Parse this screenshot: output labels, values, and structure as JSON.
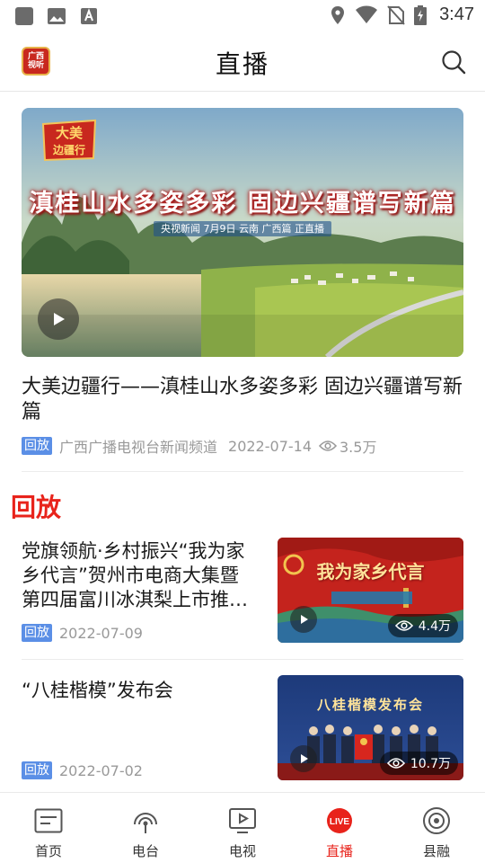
{
  "status_bar": {
    "time": "3:47"
  },
  "header": {
    "title": "直播",
    "logo_text": [
      "广西",
      "视听"
    ]
  },
  "featured": {
    "badge": [
      "大美",
      "边疆行"
    ],
    "slogan": "滇桂山水多姿多彩  固边兴疆谱写新篇",
    "subline": "央视新闻  7月9日  云南  广西篇  正直播",
    "title": "大美边疆行——滇桂山水多姿多彩 固边兴疆谱写新篇",
    "tag": "回放",
    "source": "广西广播电视台新闻频道",
    "date": "2022-07-14",
    "views": "3.5万"
  },
  "section": {
    "title": "回放"
  },
  "items": [
    {
      "title": "党旗领航·乡村振兴“我为家乡代言”贺州市电商大集暨第四届富川冰淇梨上市推介会",
      "tag": "回放",
      "date": "2022-07-09",
      "views": "4.4万",
      "thumb_caption": "我为家乡代言"
    },
    {
      "title": "“八桂楷模”发布会",
      "tag": "回放",
      "date": "2022-07-02",
      "views": "10.7万",
      "thumb_caption": "八桂楷模发布会"
    }
  ],
  "nav": [
    {
      "label": "首页",
      "icon": "news-icon",
      "active": false
    },
    {
      "label": "电台",
      "icon": "radio-icon",
      "active": false
    },
    {
      "label": "电视",
      "icon": "tv-icon",
      "active": false
    },
    {
      "label": "直播",
      "icon": "live-icon",
      "active": true
    },
    {
      "label": "县融",
      "icon": "county-icon",
      "active": false
    }
  ],
  "colors": {
    "accent": "#e8231b",
    "tag": "#5b8fe6"
  }
}
